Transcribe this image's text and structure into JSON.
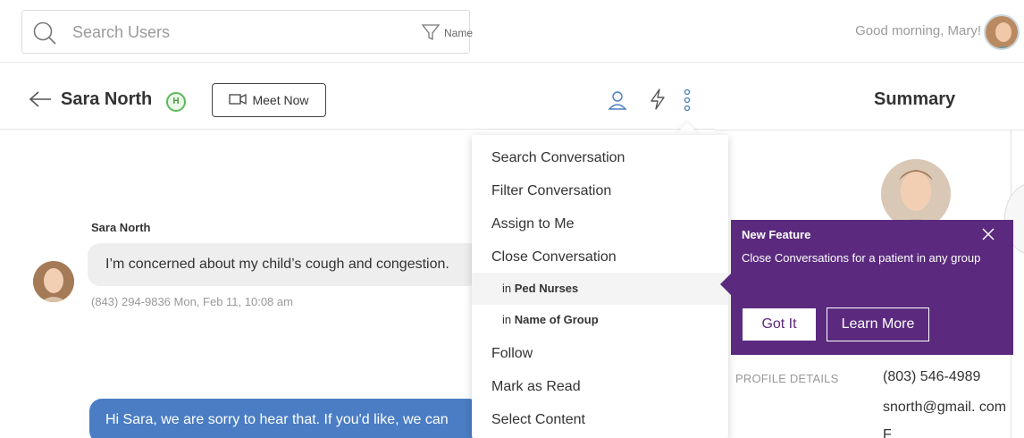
{
  "topbar": {
    "search_placeholder": "Search Users",
    "filter_label": "Name",
    "greeting": "Good morning, Mary!"
  },
  "conversation": {
    "contact_name": "Sara North",
    "badge_letter": "H",
    "meet_label": "Meet Now"
  },
  "messages": {
    "sender": "Sara North",
    "incoming_text": "I’m concerned about my child’s cough and congestion.",
    "incoming_meta": "(843) 294-9836 Mon, Feb 11, 10:08 am",
    "outgoing_text": "Hi Sara, we are sorry to hear that. If you'd like, we can"
  },
  "menu": {
    "items": [
      {
        "label": "Search Conversation"
      },
      {
        "label": "Filter Conversation"
      },
      {
        "label": "Assign to Me"
      },
      {
        "label": "Close Conversation"
      },
      {
        "prefix": "in",
        "label": "Ped Nurses"
      },
      {
        "prefix": "in",
        "label": "Name of Group"
      },
      {
        "label": "Follow"
      },
      {
        "label": "Mark as Read"
      },
      {
        "label": "Select Content"
      }
    ]
  },
  "summary": {
    "title": "Summary",
    "profile_label": "PROFILE DETAILS",
    "phone": "(803) 546-4989",
    "email": "snorth@gmail. com",
    "extra": "F"
  },
  "tooltip": {
    "title": "New Feature",
    "body": "Close Conversations for a patient in any group",
    "got_it": "Got It",
    "learn_more": "Learn More"
  },
  "colors": {
    "accent_purple": "#5b2a7e",
    "outgoing_bubble": "#4a7dc4",
    "icon_blue": "#4a7dc4",
    "badge_green": "#5cb85c"
  }
}
